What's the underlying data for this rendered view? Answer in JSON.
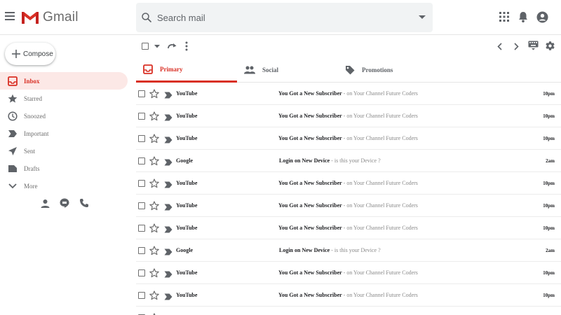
{
  "header": {
    "logo_text": "Gmail",
    "search_placeholder": "Search mail"
  },
  "sidebar": {
    "compose_label": "Compose",
    "items": [
      {
        "label": "Inbox",
        "icon": "inbox-icon",
        "active": true
      },
      {
        "label": "Starred",
        "icon": "star-icon",
        "active": false
      },
      {
        "label": "Snoozed",
        "icon": "clock-icon",
        "active": false
      },
      {
        "label": "Important",
        "icon": "important-icon",
        "active": false
      },
      {
        "label": "Sent",
        "icon": "send-icon",
        "active": false
      },
      {
        "label": "Drafts",
        "icon": "draft-icon",
        "active": false
      },
      {
        "label": "More",
        "icon": "chevron-down-icon",
        "active": false
      }
    ]
  },
  "tabs": [
    {
      "label": "Primary",
      "icon": "inbox-icon",
      "active": true
    },
    {
      "label": "Social",
      "icon": "people-icon",
      "active": false
    },
    {
      "label": "Promotions",
      "icon": "tag-icon",
      "active": false
    }
  ],
  "mails": [
    {
      "sender": "YouTube",
      "subject": "You Got a New Subscriber",
      "snippet": " - on Your Channel Future Coders",
      "time": "10pm"
    },
    {
      "sender": "YouTube",
      "subject": "You Got a New Subscriber",
      "snippet": " - on Your Channel Future Coders",
      "time": "10pm"
    },
    {
      "sender": "YouTube",
      "subject": "You Got a New Subscriber",
      "snippet": " - on Your Channel Future Coders",
      "time": "10pm"
    },
    {
      "sender": "Google",
      "subject": "Login on New Device",
      "snippet": " - is this your Device ?",
      "time": "2am"
    },
    {
      "sender": "YouTube",
      "subject": "You Got a New Subscriber",
      "snippet": " - on Your Channel Future Coders",
      "time": "10pm"
    },
    {
      "sender": "YouTube",
      "subject": "You Got a New Subscriber",
      "snippet": " - on Your Channel Future Coders",
      "time": "10pm"
    },
    {
      "sender": "YouTube",
      "subject": "You Got a New Subscriber",
      "snippet": " - on Your Channel Future Coders",
      "time": "10pm"
    },
    {
      "sender": "Google",
      "subject": "Login on New Device",
      "snippet": " - is this your Device ?",
      "time": "2am"
    },
    {
      "sender": "YouTube",
      "subject": "You Got a New Subscriber",
      "snippet": " - on Your Channel Future Coders",
      "time": "10pm"
    },
    {
      "sender": "YouTube",
      "subject": "You Got a New Subscriber",
      "snippet": " - on Your Channel Future Coders",
      "time": "10pm"
    },
    {
      "sender": "",
      "subject": "",
      "snippet": "",
      "time": ""
    }
  ],
  "colors": {
    "accent": "#d93025",
    "active_bg": "#fce8e6",
    "icon": "#5f6368"
  }
}
